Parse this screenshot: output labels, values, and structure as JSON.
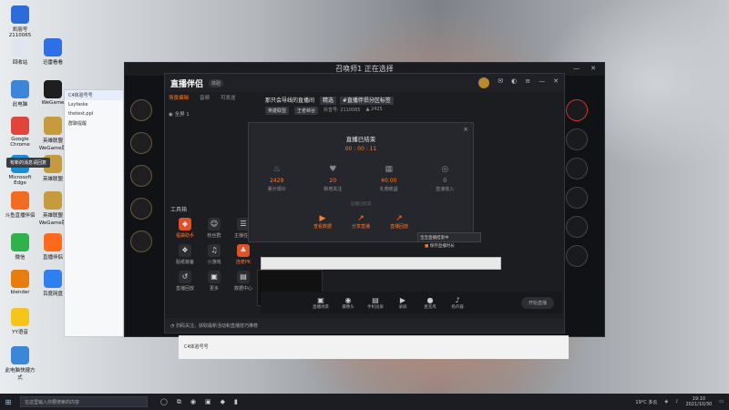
{
  "desktop": {
    "icons": [
      {
        "name": "凯丽号",
        "sub": "2110065",
        "color": "#2d6bd8",
        "icon": "user-id-icon"
      },
      {
        "name": "回收站",
        "color": "#dfe6ef",
        "icon": "recycle-bin-icon"
      },
      {
        "name": "迅雷看看",
        "color": "#2c6fe6",
        "icon": "video-player-icon"
      },
      {
        "name": "此电脑",
        "color": "#3b86d8",
        "icon": "computer-icon"
      },
      {
        "name": "WeGame",
        "color": "#1e1e1e",
        "icon": "wegame-icon"
      },
      {
        "name": "Google Chrome",
        "color": "#e0443a",
        "icon": "chrome-icon"
      },
      {
        "name": "英雄联盟WeGame版",
        "color": "#c59b3c",
        "icon": "lol-icon"
      },
      {
        "name": "Microsoft Edge",
        "color": "#1a8fd6",
        "icon": "edge-icon"
      },
      {
        "name": "英雄联盟",
        "color": "#c59b3c",
        "icon": "lol-icon"
      },
      {
        "name": "斗鱼直播伴侣",
        "color": "#f36b21",
        "icon": "douyu-icon"
      },
      {
        "name": "英雄联盟WeGame版",
        "color": "#c59b3c",
        "icon": "lol-icon"
      },
      {
        "name": "微信",
        "color": "#2fb24c",
        "icon": "wechat-icon"
      },
      {
        "name": "直播伴侣",
        "color": "#ff6a1a",
        "icon": "live-companion-icon"
      },
      {
        "name": "blender",
        "color": "#e87d0d",
        "icon": "blender-icon"
      },
      {
        "name": "百度网盘",
        "color": "#2e7ff0",
        "icon": "baidu-netdisk-icon"
      },
      {
        "name": "YY语音",
        "color": "#f5c518",
        "icon": "yy-icon"
      },
      {
        "name": "此电脑快捷方式",
        "color": "#3b86d8",
        "icon": "computer-icon"
      }
    ]
  },
  "game_window": {
    "title": "召唤师1 正在选择"
  },
  "chat_window": {
    "group": "C4体验号号",
    "rows": [
      "C4体验号号",
      "Lsyfaske",
      "thetest.ppl",
      "群聊提醒"
    ],
    "toast": "有新的消息请回复"
  },
  "app": {
    "logo": "直播伴侣",
    "logo_tag": "体验",
    "tabs": [
      "场景编辑",
      "音频",
      "可发送"
    ],
    "scene": "全屏 1",
    "room_title": "那只会导线的直播间",
    "room_chip1": "精选",
    "room_chip2": "#直播伴侣分区标签",
    "meta_chip1": "英雄联盟",
    "meta_chip2": "王者峡谷",
    "meta_text": "抖音号: 2110065",
    "meta_fans": "2425",
    "tools_title": "工具箱",
    "tools": [
      {
        "label": "福袋助手",
        "icon": "gift-bag-icon",
        "glyph": "◆",
        "hot": true
      },
      {
        "label": "粉丝群",
        "icon": "fans-icon",
        "glyph": "☺",
        "hot": false
      },
      {
        "label": "主播任务",
        "icon": "task-icon",
        "glyph": "☰",
        "hot": false
      },
      {
        "label": "贴纸装备",
        "icon": "sticker-icon",
        "glyph": "❖",
        "hot": false
      },
      {
        "label": "小游戏",
        "icon": "game-icon",
        "glyph": "♫",
        "hot": false
      },
      {
        "label": "连麦PK",
        "icon": "pk-icon",
        "glyph": "♣",
        "hot": true
      },
      {
        "label": "直播回放",
        "icon": "replay-icon",
        "glyph": "↺",
        "hot": false
      },
      {
        "label": "更多",
        "icon": "more-icon",
        "glyph": "▣",
        "hot": false
      },
      {
        "label": "数据中心",
        "icon": "data-center-icon",
        "glyph": "▤",
        "hot": false
      }
    ],
    "bottom_text": "扫码关注，获取最新活动和直播技巧推荐"
  },
  "popup": {
    "title": "直播已结束",
    "timer": "00 : 00 : 11",
    "stats": [
      {
        "value": "2429",
        "label": "累计观众",
        "icon": "fire-icon",
        "glyph": "♨"
      },
      {
        "value": "20",
        "label": "新增关注",
        "icon": "heart-icon",
        "glyph": "♥"
      },
      {
        "value": "¥0.00",
        "label": "礼物收益",
        "icon": "gift-icon",
        "glyph": "▦"
      },
      {
        "value": "0",
        "label": "音浪收入",
        "icon": "sound-wave-icon",
        "glyph": "◎"
      }
    ],
    "note": "直播已结束",
    "actions": [
      {
        "label": "查看数据",
        "icon": "video-icon",
        "glyph": "▶"
      },
      {
        "label": "分享直播",
        "icon": "share-icon",
        "glyph": "↗"
      },
      {
        "label": "直播回放",
        "icon": "replay-icon",
        "glyph": "↗"
      }
    ],
    "close": "×"
  },
  "tooltip": {
    "line1": "宝宝直播结束中",
    "line2": "保存直播时长"
  },
  "control_bar": {
    "buttons": [
      {
        "label": "直播场景",
        "icon": "scene-icon",
        "glyph": "▣"
      },
      {
        "label": "摄像头",
        "icon": "camera-icon",
        "glyph": "◉"
      },
      {
        "label": "手机投屏",
        "icon": "phone-cast-icon",
        "glyph": "▤"
      },
      {
        "label": "录屏",
        "icon": "screen-record-icon",
        "glyph": "▶"
      },
      {
        "label": "麦克风",
        "icon": "mic-icon",
        "glyph": "●"
      },
      {
        "label": "扬声器",
        "icon": "speaker-icon",
        "glyph": "♪"
      }
    ],
    "start_label": "开始直播"
  },
  "strip": {
    "text": "C4体验号号"
  },
  "taskbar": {
    "start_glyph": "⊞",
    "search_placeholder": "在这里输入你要搜索的内容",
    "weather": "19°C 多云",
    "time": "19:10",
    "date": "2021/10/30",
    "apps": [
      "◯",
      "⧉",
      "◉",
      "▣",
      "◆",
      "▮"
    ]
  }
}
